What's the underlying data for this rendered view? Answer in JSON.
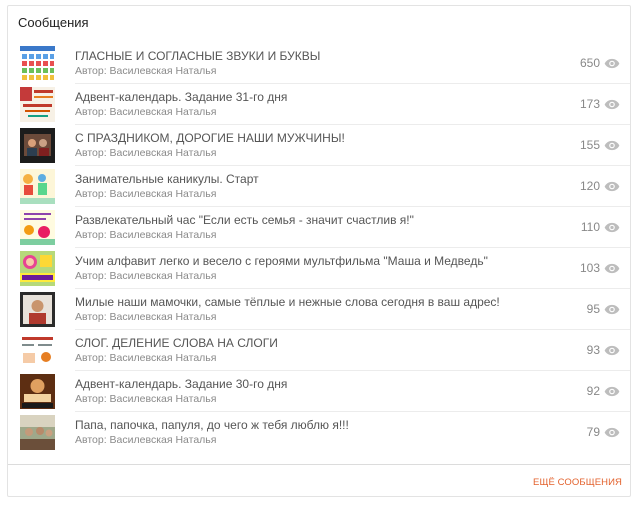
{
  "panel": {
    "title": "Сообщения",
    "more_label": "ЕЩЁ СООБЩЕНИЯ",
    "accent_color": "#e3622d"
  },
  "posts": [
    {
      "title": "ГЛАСНЫЕ И СОГЛАСНЫЕ ЗВУКИ И БУКВЫ",
      "author": "Автор: Василевская Наталья",
      "views": "650",
      "thumb": "alphabet-chart"
    },
    {
      "title": "Адвент-календарь. Задание 31-го дня",
      "author": "Автор: Василевская Наталья",
      "views": "173",
      "thumb": "advent-poster"
    },
    {
      "title": "С ПРАЗДНИКОМ, ДОРОГИЕ НАШИ МУЖЧИНЫ!",
      "author": "Автор: Василевская Наталья",
      "views": "155",
      "thumb": "video-frame"
    },
    {
      "title": "Занимательные каникулы. Старт",
      "author": "Автор: Василевская Наталья",
      "views": "120",
      "thumb": "cartoon-children"
    },
    {
      "title": "Развлекательный час \"Если есть семья - значит счастлив я!\"",
      "author": "Автор: Василевская Наталья",
      "views": "110",
      "thumb": "family-poster"
    },
    {
      "title": "Учим алфавит легко и весело с героями мультфильма \"Маша и Медведь\"",
      "author": "Автор: Василевская Наталья",
      "views": "103",
      "thumb": "alphabet-cartoon"
    },
    {
      "title": "Милые наши мамочки, самые тёплые и нежные слова сегодня в ваш адрес!",
      "author": "Автор: Василевская Наталья",
      "views": "95",
      "thumb": "video-portrait"
    },
    {
      "title": "СЛОГ. ДЕЛЕНИЕ СЛОВА НА СЛОГИ",
      "author": "Автор: Василевская Наталья",
      "views": "93",
      "thumb": "syllable-card"
    },
    {
      "title": "Адвент-календарь. Задание 30-го дня",
      "author": "Автор: Василевская Наталья",
      "views": "92",
      "thumb": "advent-book"
    },
    {
      "title": "Папа, папочка, папуля, до чего ж тебя люблю я!!!",
      "author": "Автор: Василевская Наталья",
      "views": "79",
      "thumb": "classroom-photo"
    }
  ]
}
